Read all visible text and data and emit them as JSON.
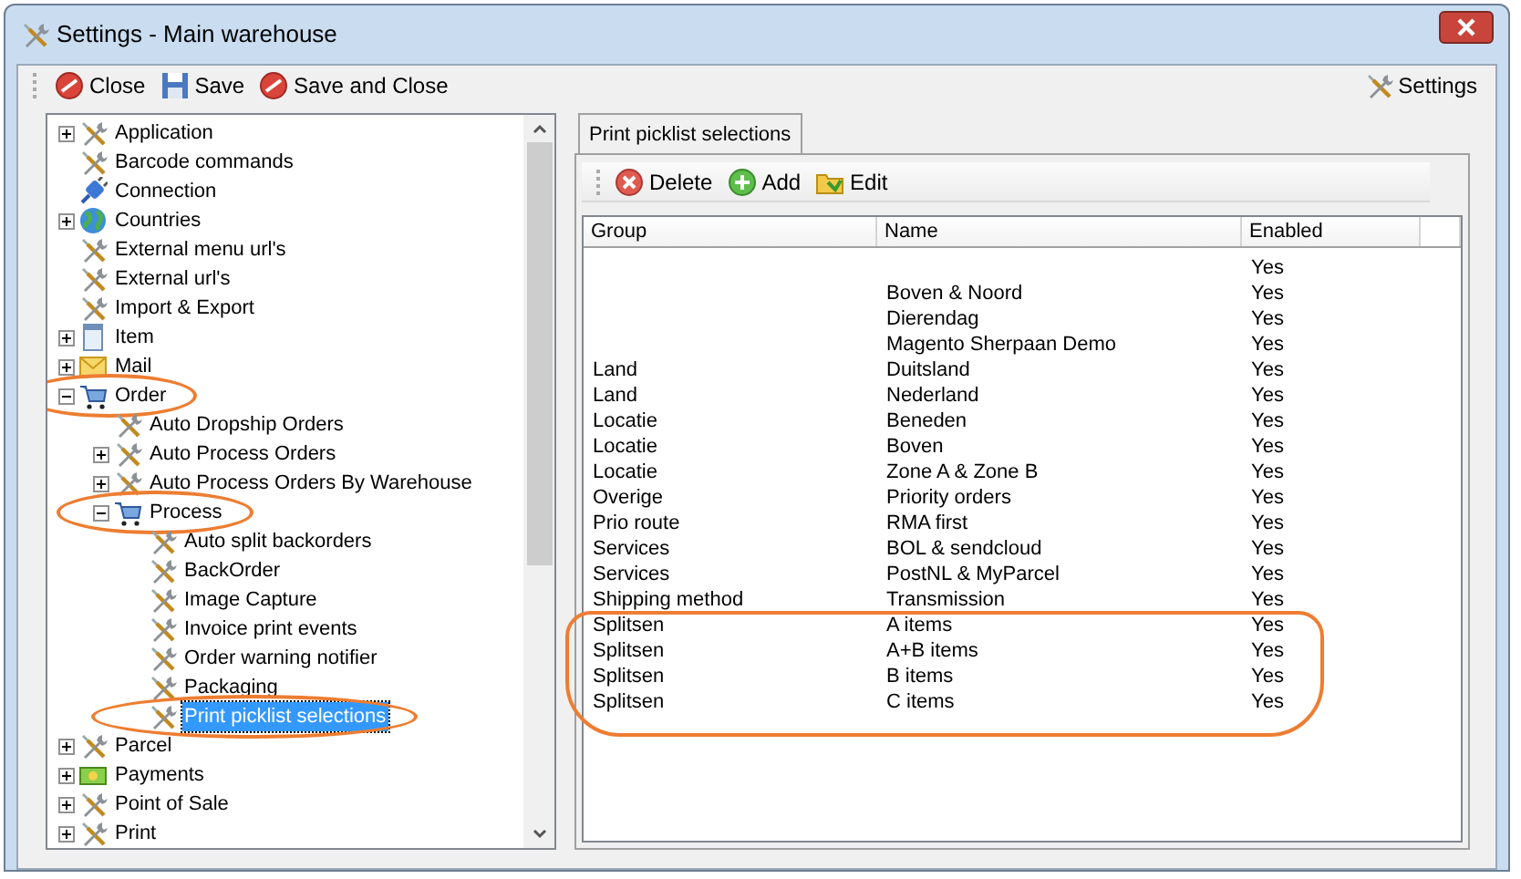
{
  "window": {
    "title": "Settings - Main warehouse"
  },
  "toolbar": {
    "buttons": [
      {
        "label": "Close",
        "kind": "cancel"
      },
      {
        "label": "Save",
        "kind": "floppy"
      },
      {
        "label": "Save and Close",
        "kind": "cancel"
      }
    ],
    "settings": {
      "label": "Settings",
      "kind": "tools"
    }
  },
  "tree": [
    {
      "label": "Application",
      "kind": "tools",
      "expanded": false,
      "selected": false,
      "highlighted": false
    },
    {
      "label": "Barcode commands",
      "kind": "tools",
      "selected": false,
      "highlighted": false
    },
    {
      "label": "Connection",
      "kind": "plug",
      "selected": false,
      "highlighted": false
    },
    {
      "label": "Countries",
      "kind": "globe",
      "expanded": false,
      "selected": false,
      "highlighted": false
    },
    {
      "label": "External menu url's",
      "kind": "tools",
      "selected": false,
      "highlighted": false
    },
    {
      "label": "External url's",
      "kind": "tools",
      "selected": false,
      "highlighted": false
    },
    {
      "label": "Import & Export",
      "kind": "tools",
      "selected": false,
      "highlighted": false
    },
    {
      "label": "Item",
      "kind": "document",
      "expanded": false,
      "selected": false,
      "highlighted": false
    },
    {
      "label": "Mail",
      "kind": "mail",
      "expanded": false,
      "selected": false,
      "highlighted": false
    },
    {
      "label": "Order",
      "kind": "cart",
      "expanded": true,
      "selected": false,
      "highlighted": true,
      "children": [
        {
          "label": "Auto Dropship Orders",
          "kind": "tools",
          "selected": false,
          "highlighted": false
        },
        {
          "label": "Auto Process Orders",
          "kind": "tools",
          "expanded": false,
          "selected": false,
          "highlighted": false
        },
        {
          "label": "Auto Process Orders By Warehouse",
          "kind": "tools",
          "expanded": false,
          "selected": false,
          "highlighted": false
        },
        {
          "label": "Process",
          "kind": "cart",
          "expanded": true,
          "selected": false,
          "highlighted": true,
          "children": [
            {
              "label": "Auto split backorders",
              "kind": "tools",
              "selected": false,
              "highlighted": false
            },
            {
              "label": "BackOrder",
              "kind": "tools",
              "selected": false,
              "highlighted": false
            },
            {
              "label": "Image Capture",
              "kind": "tools",
              "selected": false,
              "highlighted": false
            },
            {
              "label": "Invoice print events",
              "kind": "tools",
              "selected": false,
              "highlighted": false
            },
            {
              "label": "Order warning notifier",
              "kind": "tools",
              "selected": false,
              "highlighted": false
            },
            {
              "label": "Packaging",
              "kind": "tools",
              "selected": false,
              "highlighted": false
            },
            {
              "label": "Print picklist selections",
              "kind": "tools",
              "selected": true,
              "highlighted": true
            }
          ]
        }
      ]
    },
    {
      "label": "Parcel",
      "kind": "tools",
      "expanded": false,
      "selected": false,
      "highlighted": false
    },
    {
      "label": "Payments",
      "kind": "money",
      "expanded": false,
      "selected": false,
      "highlighted": false
    },
    {
      "label": "Point of Sale",
      "kind": "tools",
      "expanded": false,
      "selected": false,
      "highlighted": false
    },
    {
      "label": "Print",
      "kind": "tools",
      "expanded": false,
      "selected": false,
      "highlighted": false
    }
  ],
  "tabs": [
    {
      "label": "Print picklist selections",
      "selected": true
    }
  ],
  "panel_toolbar": [
    {
      "label": "Delete",
      "kind": "delete"
    },
    {
      "label": "Add",
      "kind": "add"
    },
    {
      "label": "Edit",
      "kind": "edit"
    }
  ],
  "table": {
    "columns": [
      "Group",
      "Name",
      "Enabled"
    ],
    "rows": [
      {
        "group": "",
        "name": "",
        "enabled": "Yes",
        "highlighted": false
      },
      {
        "group": "",
        "name": "Boven & Noord",
        "enabled": "Yes",
        "highlighted": false
      },
      {
        "group": "",
        "name": "Dierendag",
        "enabled": "Yes",
        "highlighted": false
      },
      {
        "group": "",
        "name": "Magento Sherpaan Demo",
        "enabled": "Yes",
        "highlighted": false
      },
      {
        "group": "Land",
        "name": "Duitsland",
        "enabled": "Yes",
        "highlighted": false
      },
      {
        "group": "Land",
        "name": "Nederland",
        "enabled": "Yes",
        "highlighted": false
      },
      {
        "group": "Locatie",
        "name": "Beneden",
        "enabled": "Yes",
        "highlighted": false
      },
      {
        "group": "Locatie",
        "name": "Boven",
        "enabled": "Yes",
        "highlighted": false
      },
      {
        "group": "Locatie",
        "name": "Zone A & Zone B",
        "enabled": "Yes",
        "highlighted": false
      },
      {
        "group": "Overige",
        "name": "Priority orders",
        "enabled": "Yes",
        "highlighted": false
      },
      {
        "group": "Prio route",
        "name": "RMA first",
        "enabled": "Yes",
        "highlighted": false
      },
      {
        "group": "Services",
        "name": "BOL & sendcloud",
        "enabled": "Yes",
        "highlighted": false
      },
      {
        "group": "Services",
        "name": "PostNL & MyParcel",
        "enabled": "Yes",
        "highlighted": false
      },
      {
        "group": "Shipping method",
        "name": "Transmission",
        "enabled": "Yes",
        "highlighted": false
      },
      {
        "group": "Splitsen",
        "name": "A items",
        "enabled": "Yes",
        "highlighted": true
      },
      {
        "group": "Splitsen",
        "name": "A+B items",
        "enabled": "Yes",
        "highlighted": true
      },
      {
        "group": "Splitsen",
        "name": "B items",
        "enabled": "Yes",
        "highlighted": true
      },
      {
        "group": "Splitsen",
        "name": "C items",
        "enabled": "Yes",
        "highlighted": true
      }
    ]
  }
}
